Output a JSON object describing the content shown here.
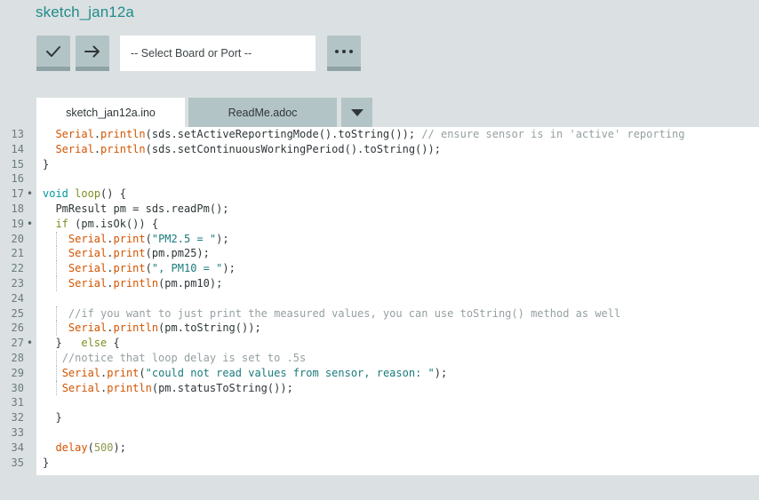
{
  "window": {
    "sketch_title": "sketch_jan12a",
    "background_color": "#dbe1e2",
    "title_color": "#218a8c"
  },
  "toolbar": {
    "verify_label": "Verify",
    "verify_icon": "checkmark-icon",
    "upload_label": "Upload",
    "upload_icon": "arrow-right-icon",
    "board_selector_value": "-- Select Board or Port --",
    "board_selector_placeholder": "-- Select Board or Port --",
    "more_label": "…",
    "more_icon": "ellipsis-icon",
    "button_color": "#b3c4c6",
    "button_underline_color": "#8fa3a6"
  },
  "tabs": {
    "items": [
      {
        "label": "sketch_jan12a.ino",
        "active": true
      },
      {
        "label": "ReadMe.adoc",
        "active": false
      }
    ],
    "menu_icon": "chevron-down-icon",
    "active_bg": "#ffffff",
    "inactive_bg": "#b3c4c6"
  },
  "editor": {
    "background": "#ffffff",
    "gutter_background": "#dbe1e2",
    "line_number_color": "#6b7a7c",
    "first_visible_line": 13,
    "last_visible_line": 35,
    "lines": [
      {
        "num": "13",
        "fold": "",
        "indent_guides": [],
        "tokens": [
          {
            "t": "  ",
            "c": "t-plain"
          },
          {
            "t": "Serial",
            "c": "t-fn"
          },
          {
            "t": ".",
            "c": "t-plain"
          },
          {
            "t": "println",
            "c": "t-fn"
          },
          {
            "t": "(sds.setActiveReportingMode().toString()); ",
            "c": "t-plain"
          },
          {
            "t": "// ensure sensor is in 'active' reporting",
            "c": "t-com"
          }
        ]
      },
      {
        "num": "14",
        "fold": "",
        "indent_guides": [],
        "tokens": [
          {
            "t": "  ",
            "c": "t-plain"
          },
          {
            "t": "Serial",
            "c": "t-fn"
          },
          {
            "t": ".",
            "c": "t-plain"
          },
          {
            "t": "println",
            "c": "t-fn"
          },
          {
            "t": "(sds.setContinuousWorkingPeriod().toString());",
            "c": "t-plain"
          }
        ]
      },
      {
        "num": "15",
        "fold": "",
        "indent_guides": [],
        "tokens": [
          {
            "t": "}",
            "c": "t-plain"
          }
        ]
      },
      {
        "num": "16",
        "fold": "",
        "indent_guides": [],
        "tokens": []
      },
      {
        "num": "17",
        "fold": "•",
        "indent_guides": [],
        "tokens": [
          {
            "t": "void",
            "c": "t-kw"
          },
          {
            "t": " ",
            "c": "t-plain"
          },
          {
            "t": "loop",
            "c": "t-ctl"
          },
          {
            "t": "() {",
            "c": "t-plain"
          }
        ]
      },
      {
        "num": "18",
        "fold": "",
        "indent_guides": [],
        "tokens": [
          {
            "t": "  PmResult pm = sds.readPm();",
            "c": "t-plain"
          }
        ]
      },
      {
        "num": "19",
        "fold": "•",
        "indent_guides": [],
        "tokens": [
          {
            "t": "  ",
            "c": "t-plain"
          },
          {
            "t": "if",
            "c": "t-ctl"
          },
          {
            "t": " (pm.isOk()) {",
            "c": "t-plain"
          }
        ]
      },
      {
        "num": "20",
        "fold": "",
        "indent_guides": [
          22
        ],
        "tokens": [
          {
            "t": "    ",
            "c": "t-plain"
          },
          {
            "t": "Serial",
            "c": "t-fn"
          },
          {
            "t": ".",
            "c": "t-plain"
          },
          {
            "t": "print",
            "c": "t-fn"
          },
          {
            "t": "(",
            "c": "t-plain"
          },
          {
            "t": "\"PM2.5 = \"",
            "c": "t-str"
          },
          {
            "t": ");",
            "c": "t-plain"
          }
        ]
      },
      {
        "num": "21",
        "fold": "",
        "indent_guides": [
          22
        ],
        "tokens": [
          {
            "t": "    ",
            "c": "t-plain"
          },
          {
            "t": "Serial",
            "c": "t-fn"
          },
          {
            "t": ".",
            "c": "t-plain"
          },
          {
            "t": "print",
            "c": "t-fn"
          },
          {
            "t": "(pm.pm25);",
            "c": "t-plain"
          }
        ]
      },
      {
        "num": "22",
        "fold": "",
        "indent_guides": [
          22
        ],
        "tokens": [
          {
            "t": "    ",
            "c": "t-plain"
          },
          {
            "t": "Serial",
            "c": "t-fn"
          },
          {
            "t": ".",
            "c": "t-plain"
          },
          {
            "t": "print",
            "c": "t-fn"
          },
          {
            "t": "(",
            "c": "t-plain"
          },
          {
            "t": "\", PM10 = \"",
            "c": "t-str"
          },
          {
            "t": ");",
            "c": "t-plain"
          }
        ]
      },
      {
        "num": "23",
        "fold": "",
        "indent_guides": [
          22
        ],
        "tokens": [
          {
            "t": "    ",
            "c": "t-plain"
          },
          {
            "t": "Serial",
            "c": "t-fn"
          },
          {
            "t": ".",
            "c": "t-plain"
          },
          {
            "t": "println",
            "c": "t-fn"
          },
          {
            "t": "(pm.pm10);",
            "c": "t-plain"
          }
        ]
      },
      {
        "num": "24",
        "fold": "",
        "indent_guides": [],
        "tokens": []
      },
      {
        "num": "25",
        "fold": "",
        "indent_guides": [
          22
        ],
        "tokens": [
          {
            "t": "    ",
            "c": "t-plain"
          },
          {
            "t": "//if you want to just print the measured values, you can use toString() method as well",
            "c": "t-com"
          }
        ]
      },
      {
        "num": "26",
        "fold": "",
        "indent_guides": [
          22
        ],
        "tokens": [
          {
            "t": "    ",
            "c": "t-plain"
          },
          {
            "t": "Serial",
            "c": "t-fn"
          },
          {
            "t": ".",
            "c": "t-plain"
          },
          {
            "t": "println",
            "c": "t-fn"
          },
          {
            "t": "(pm.toString());",
            "c": "t-plain"
          }
        ]
      },
      {
        "num": "27",
        "fold": "•",
        "indent_guides": [],
        "tokens": [
          {
            "t": "  }   ",
            "c": "t-plain"
          },
          {
            "t": "else",
            "c": "t-ctl"
          },
          {
            "t": " {",
            "c": "t-plain"
          }
        ]
      },
      {
        "num": "28",
        "fold": "",
        "indent_guides": [
          22
        ],
        "tokens": [
          {
            "t": "   ",
            "c": "t-plain"
          },
          {
            "t": "//notice that loop delay is set to .5s",
            "c": "t-com"
          }
        ]
      },
      {
        "num": "29",
        "fold": "",
        "indent_guides": [
          22
        ],
        "tokens": [
          {
            "t": "   ",
            "c": "t-plain"
          },
          {
            "t": "Serial",
            "c": "t-fn"
          },
          {
            "t": ".",
            "c": "t-plain"
          },
          {
            "t": "print",
            "c": "t-fn"
          },
          {
            "t": "(",
            "c": "t-plain"
          },
          {
            "t": "\"could not read values from sensor, reason: \"",
            "c": "t-str"
          },
          {
            "t": ");",
            "c": "t-plain"
          }
        ]
      },
      {
        "num": "30",
        "fold": "",
        "indent_guides": [
          22
        ],
        "tokens": [
          {
            "t": "   ",
            "c": "t-plain"
          },
          {
            "t": "Serial",
            "c": "t-fn"
          },
          {
            "t": ".",
            "c": "t-plain"
          },
          {
            "t": "println",
            "c": "t-fn"
          },
          {
            "t": "(pm.statusToString());",
            "c": "t-plain"
          }
        ]
      },
      {
        "num": "31",
        "fold": "",
        "indent_guides": [],
        "tokens": []
      },
      {
        "num": "32",
        "fold": "",
        "indent_guides": [],
        "tokens": [
          {
            "t": "  }",
            "c": "t-plain"
          }
        ]
      },
      {
        "num": "33",
        "fold": "",
        "indent_guides": [],
        "tokens": []
      },
      {
        "num": "34",
        "fold": "",
        "indent_guides": [],
        "tokens": [
          {
            "t": "  ",
            "c": "t-plain"
          },
          {
            "t": "delay",
            "c": "t-fn"
          },
          {
            "t": "(",
            "c": "t-plain"
          },
          {
            "t": "500",
            "c": "t-num"
          },
          {
            "t": ");",
            "c": "t-plain"
          }
        ]
      },
      {
        "num": "35",
        "fold": "",
        "indent_guides": [],
        "tokens": [
          {
            "t": "}",
            "c": "t-plain"
          }
        ]
      }
    ]
  }
}
